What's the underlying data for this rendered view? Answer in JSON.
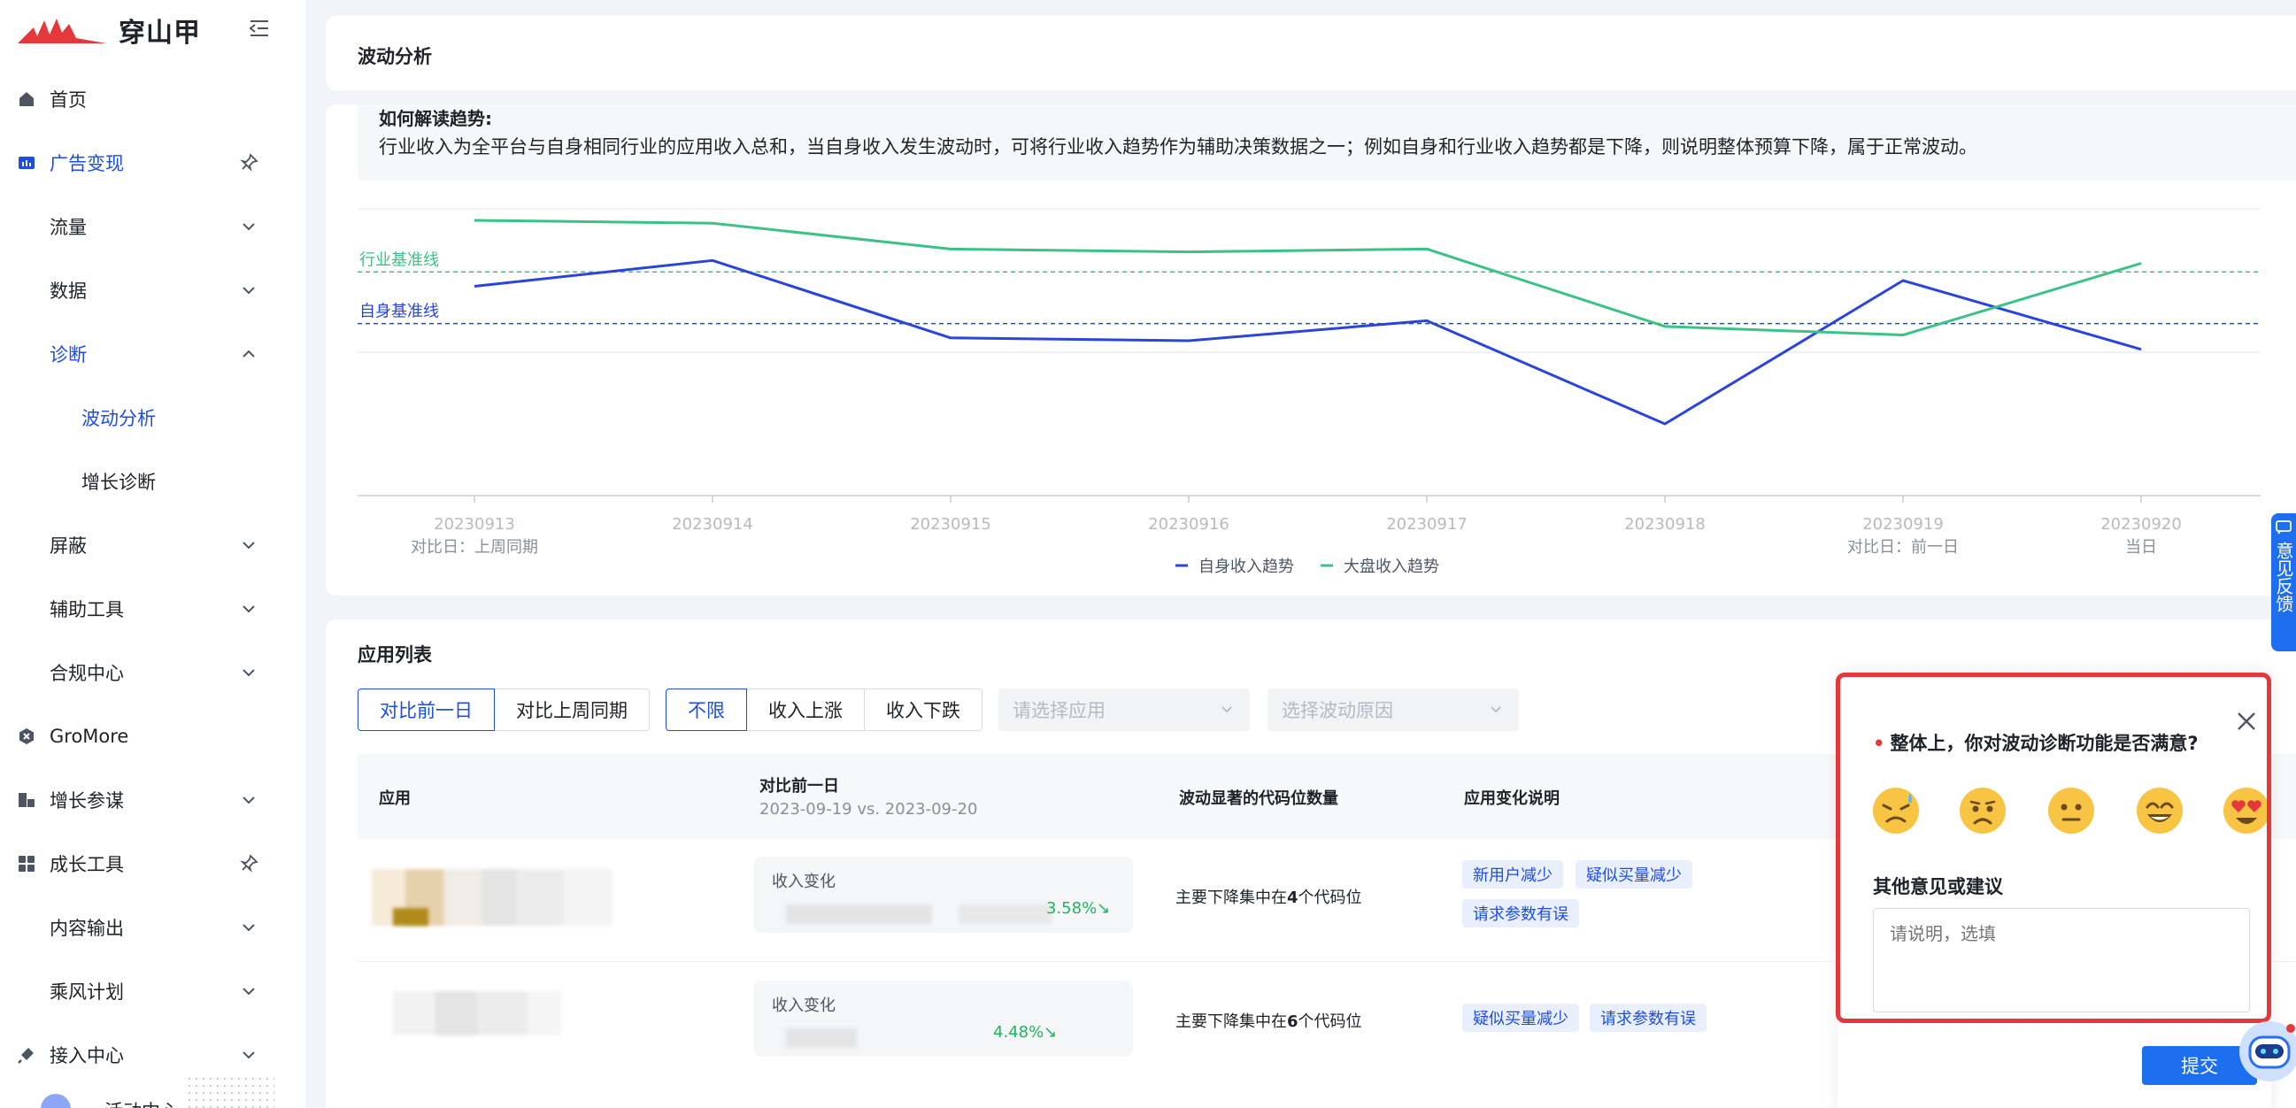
{
  "brand": {
    "name": "穿山甲",
    "primary_color": "#1e4ee0",
    "logo_color": "#e5383b"
  },
  "sidebar": {
    "items": [
      {
        "label": "首页",
        "icon": "home-icon",
        "level": 1
      },
      {
        "label": "广告变现",
        "icon": "bar-chart-icon",
        "level": 1,
        "active": true,
        "pinned": true
      },
      {
        "label": "流量",
        "level": 2,
        "expandable": true
      },
      {
        "label": "数据",
        "level": 2,
        "expandable": true
      },
      {
        "label": "诊断",
        "level": 2,
        "expanded": true,
        "active": true
      },
      {
        "label": "波动分析",
        "level": 3,
        "active": true
      },
      {
        "label": "增长诊断",
        "level": 3
      },
      {
        "label": "屏蔽",
        "level": 2,
        "expandable": true
      },
      {
        "label": "辅助工具",
        "level": 2,
        "expandable": true
      },
      {
        "label": "合规中心",
        "level": 2,
        "expandable": true
      },
      {
        "label": "GroMore",
        "icon": "gromore-icon",
        "level": 1
      },
      {
        "label": "增长参谋",
        "icon": "advisor-icon",
        "level": 1,
        "expandable": true
      },
      {
        "label": "成长工具",
        "icon": "grid-icon",
        "level": 1,
        "pinned": true
      },
      {
        "label": "内容输出",
        "level": 2,
        "expandable": true
      },
      {
        "label": "乘风计划",
        "level": 2,
        "expandable": true
      },
      {
        "label": "接入中心",
        "icon": "plug-icon",
        "level": 1,
        "expandable": true
      }
    ],
    "bottom_label": "活动中心"
  },
  "header": {
    "title": "波动分析"
  },
  "trend_info": {
    "title": "如何解读趋势:",
    "text": "行业收入为全平台与自身相同行业的应用收入总和，当自身收入发生波动时，可将行业收入趋势作为辅助决策数据之一；例如自身和行业收入趋势都是下降，则说明整体预算下降，属于正常波动。"
  },
  "chart_data": {
    "type": "line",
    "categories": [
      "20230913",
      "20230914",
      "20230915",
      "20230916",
      "20230917",
      "20230918",
      "20230919",
      "20230920"
    ],
    "category_sublabels": [
      "对比日：上周同期",
      "",
      "",
      "",
      "",
      "",
      "对比日：前一日",
      "当日"
    ],
    "series": [
      {
        "name": "自身收入趋势",
        "color": "#2a45d8",
        "values": [
          0.73,
          0.82,
          0.55,
          0.54,
          0.61,
          0.25,
          0.75,
          0.51
        ]
      },
      {
        "name": "大盘收入趋势",
        "color": "#3cc288",
        "values": [
          0.96,
          0.95,
          0.86,
          0.85,
          0.86,
          0.59,
          0.56,
          0.81
        ]
      }
    ],
    "reference_lines": [
      {
        "label": "行业基准线",
        "value": 0.78,
        "color": "#3cc288"
      },
      {
        "label": "自身基准线",
        "value": 0.6,
        "color": "#2a45d8"
      }
    ],
    "y_axis_visible": false,
    "grid": true,
    "legend_position": "bottom-center"
  },
  "app_list": {
    "title": "应用列表",
    "compare_options": [
      {
        "label": "对比前一日",
        "selected": true
      },
      {
        "label": "对比上周同期",
        "selected": false
      }
    ],
    "filter_options": [
      {
        "label": "不限",
        "selected": true
      },
      {
        "label": "收入上涨",
        "selected": false
      },
      {
        "label": "收入下跌",
        "selected": false
      }
    ],
    "select_app_placeholder": "请选择应用",
    "select_reason_placeholder": "选择波动原因",
    "columns": {
      "app": "应用",
      "compare": "对比前一日",
      "compare_range": "2023-09-19 vs. 2023-09-20",
      "slots": "波动显著的代码位数量",
      "desc": "应用变化说明"
    },
    "rows": [
      {
        "revenue_label": "收入变化",
        "revenue_pct": "3.58%↘",
        "slots_text_pre": "主要下降集中在",
        "slots_count": "4",
        "slots_text_post": "个代码位",
        "tags": [
          "新用户减少",
          "疑似买量减少",
          "请求参数有误"
        ]
      },
      {
        "revenue_label": "收入变化",
        "revenue_pct": "4.48%↘",
        "slots_text_pre": "主要下降集中在",
        "slots_count": "6",
        "slots_text_post": "个代码位",
        "tags": [
          "疑似买量减少",
          "请求参数有误"
        ]
      }
    ]
  },
  "feedback": {
    "question": "整体上，你对波动诊断功能是否满意?",
    "required_mark": "•",
    "emojis": [
      "sweating-face-icon",
      "frowning-face-icon",
      "neutral-face-icon",
      "grinning-face-icon",
      "heart-eyes-face-icon"
    ],
    "suggestion_label": "其他意见或建议",
    "suggestion_placeholder": "请说明，选填",
    "submit_label": "提交"
  },
  "side_tab": {
    "label": "意见反馈"
  }
}
